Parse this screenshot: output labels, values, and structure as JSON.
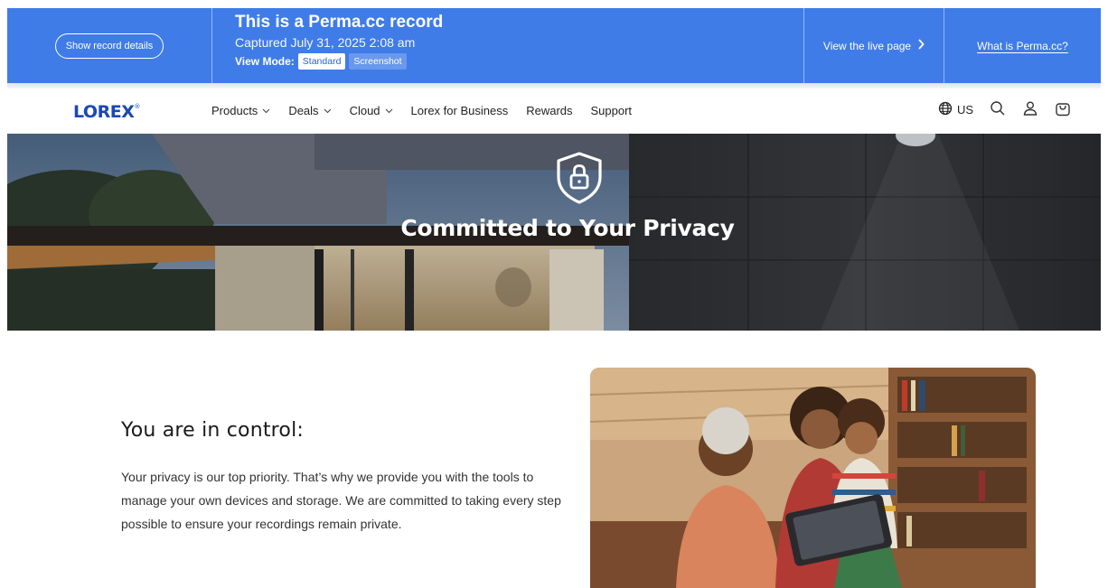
{
  "perma": {
    "details_button": "Show record details",
    "title": "This is a Perma.cc record",
    "captured": "Captured July 31, 2025 2:08 am",
    "view_mode_label": "View Mode:",
    "mode_standard": "Standard",
    "mode_screenshot": "Screenshot",
    "live_link": "View the live page",
    "live_chevron": "›",
    "what_link": "What is Perma.cc?"
  },
  "header": {
    "logo": "LOREX",
    "logo_mark": "®",
    "nav": [
      {
        "label": "Products",
        "dropdown": true
      },
      {
        "label": "Deals",
        "dropdown": true
      },
      {
        "label": "Cloud",
        "dropdown": true
      },
      {
        "label": "Lorex for Business",
        "dropdown": false
      },
      {
        "label": "Rewards",
        "dropdown": false
      },
      {
        "label": "Support",
        "dropdown": false
      }
    ],
    "region": "US",
    "icons": [
      "globe-icon",
      "search-icon",
      "account-icon",
      "cart-icon"
    ]
  },
  "hero": {
    "title": "Committed to Your Privacy",
    "icon": "lock-shield-icon"
  },
  "content": {
    "heading": "You are in control:",
    "body": "Your privacy is our top priority. That’s why we provide you with the tools to manage your own devices and storage. We are committed to taking every step possible to ensure your recordings remain private."
  },
  "colors": {
    "perma_blue": "#3f7ce8",
    "lorex_blue": "#1b48b3"
  }
}
